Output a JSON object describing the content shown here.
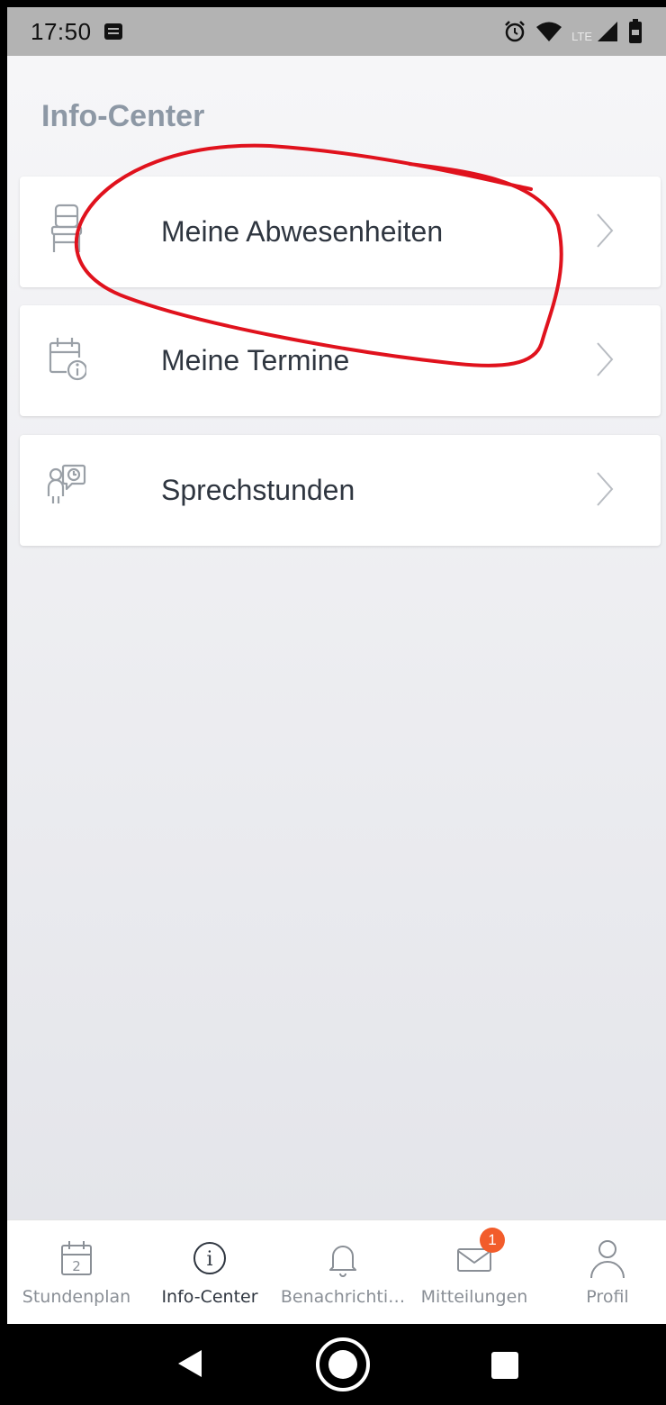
{
  "status_bar": {
    "time": "17:50",
    "network": "LTE"
  },
  "header": {
    "title": "Info-Center"
  },
  "menu": {
    "items": [
      {
        "label": "Meine Abwesenheiten",
        "icon": "chair-icon"
      },
      {
        "label": "Meine Termine",
        "icon": "calendar-info-icon"
      },
      {
        "label": "Sprechstunden",
        "icon": "person-clock-icon"
      }
    ]
  },
  "tabbar": {
    "tabs": [
      {
        "label": "Stundenplan",
        "icon": "calendar-icon",
        "icon_text": "2",
        "active": false
      },
      {
        "label": "Info-Center",
        "icon": "info-icon",
        "icon_text": "i",
        "active": true
      },
      {
        "label": "Benachrichti…",
        "icon": "bell-icon",
        "active": false
      },
      {
        "label": "Mitteilungen",
        "icon": "mail-icon",
        "badge": "1",
        "active": false
      },
      {
        "label": "Profil",
        "icon": "person-icon",
        "active": false
      }
    ]
  },
  "colors": {
    "badge": "#f25c2b",
    "annotation": "#e0121d",
    "title": "#8d98a5"
  }
}
